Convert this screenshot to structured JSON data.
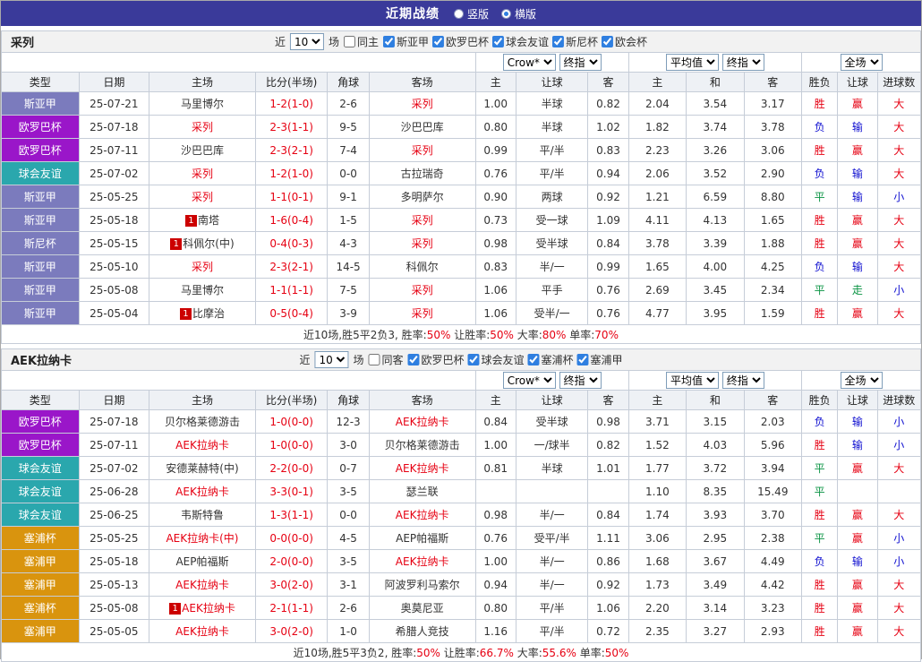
{
  "header": {
    "title": "近期战绩",
    "views": [
      {
        "label": "竖版",
        "selected": false
      },
      {
        "label": "横版",
        "selected": true
      }
    ]
  },
  "labels": {
    "near": "近",
    "games": "场"
  },
  "columns": [
    "类型",
    "日期",
    "主场",
    "比分(半场)",
    "角球",
    "客场",
    "主",
    "让球",
    "客",
    "主",
    "和",
    "客",
    "胜负",
    "让球",
    "进球数"
  ],
  "selects": {
    "provider": "Crow*",
    "final": "终指",
    "avg": "平均值",
    "scope": "全场"
  },
  "league_colors": {
    "斯亚甲": "#7b7bbd",
    "欧罗巴杯": "#9a16c9",
    "球会友谊": "#2aa7ad",
    "斯尼杯": "#7b7bbd",
    "欧会杯": "#7b7bbd",
    "塞浦杯": "#d9940e",
    "塞浦甲": "#d9940e"
  },
  "result_colors": {
    "胜": "#e60012",
    "负": "#1010d0",
    "平": "#0b9444",
    "赢": "#e60012",
    "输": "#1010d0",
    "走": "#0b9444",
    "大": "#e60012",
    "小": "#1010d0"
  },
  "tables": [
    {
      "team": "采列",
      "filter": {
        "count": "10",
        "same_label": "同主",
        "leagues": [
          "斯亚甲",
          "欧罗巴杯",
          "球会友谊",
          "斯尼杯",
          "欧会杯"
        ]
      },
      "rows": [
        {
          "league": "斯亚甲",
          "date": "25-07-21",
          "home": "马里博尔",
          "home_red": false,
          "home_badge": false,
          "score": "1-2(1-0)",
          "corner": "2-6",
          "away": "采列",
          "away_red": true,
          "away_badge": false,
          "odds": [
            "1.00",
            "半球",
            "0.82",
            "2.04",
            "3.54",
            "3.17"
          ],
          "res": [
            "胜",
            "赢",
            "大"
          ]
        },
        {
          "league": "欧罗巴杯",
          "date": "25-07-18",
          "home": "采列",
          "home_red": true,
          "home_badge": false,
          "score": "2-3(1-1)",
          "corner": "9-5",
          "away": "沙巴巴库",
          "away_red": false,
          "away_badge": false,
          "odds": [
            "0.80",
            "半球",
            "1.02",
            "1.82",
            "3.74",
            "3.78"
          ],
          "res": [
            "负",
            "输",
            "大"
          ]
        },
        {
          "league": "欧罗巴杯",
          "date": "25-07-11",
          "home": "沙巴巴库",
          "home_red": false,
          "home_badge": false,
          "score": "2-3(2-1)",
          "corner": "7-4",
          "away": "采列",
          "away_red": true,
          "away_badge": false,
          "odds": [
            "0.99",
            "平/半",
            "0.83",
            "2.23",
            "3.26",
            "3.06"
          ],
          "res": [
            "胜",
            "赢",
            "大"
          ]
        },
        {
          "league": "球会友谊",
          "date": "25-07-02",
          "home": "采列",
          "home_red": true,
          "home_badge": false,
          "score": "1-2(1-0)",
          "corner": "0-0",
          "away": "古拉瑞奇",
          "away_red": false,
          "away_badge": false,
          "odds": [
            "0.76",
            "平/半",
            "0.94",
            "2.06",
            "3.52",
            "2.90"
          ],
          "res": [
            "负",
            "输",
            "大"
          ]
        },
        {
          "league": "斯亚甲",
          "date": "25-05-25",
          "home": "采列",
          "home_red": true,
          "home_badge": false,
          "score": "1-1(0-1)",
          "corner": "9-1",
          "away": "多明萨尔",
          "away_red": false,
          "away_badge": false,
          "odds": [
            "0.90",
            "两球",
            "0.92",
            "1.21",
            "6.59",
            "8.80"
          ],
          "res": [
            "平",
            "输",
            "小"
          ]
        },
        {
          "league": "斯亚甲",
          "date": "25-05-18",
          "home": "南塔",
          "home_red": false,
          "home_badge": true,
          "score": "1-6(0-4)",
          "corner": "1-5",
          "away": "采列",
          "away_red": true,
          "away_badge": false,
          "odds": [
            "0.73",
            "受一球",
            "1.09",
            "4.11",
            "4.13",
            "1.65"
          ],
          "res": [
            "胜",
            "赢",
            "大"
          ]
        },
        {
          "league": "斯尼杯",
          "date": "25-05-15",
          "home": "科佩尔(中)",
          "home_red": false,
          "home_badge": true,
          "score": "0-4(0-3)",
          "corner": "4-3",
          "away": "采列",
          "away_red": true,
          "away_badge": false,
          "odds": [
            "0.98",
            "受半球",
            "0.84",
            "3.78",
            "3.39",
            "1.88"
          ],
          "res": [
            "胜",
            "赢",
            "大"
          ]
        },
        {
          "league": "斯亚甲",
          "date": "25-05-10",
          "home": "采列",
          "home_red": true,
          "home_badge": false,
          "score": "2-3(2-1)",
          "corner": "14-5",
          "away": "科佩尔",
          "away_red": false,
          "away_badge": false,
          "odds": [
            "0.83",
            "半/一",
            "0.99",
            "1.65",
            "4.00",
            "4.25"
          ],
          "res": [
            "负",
            "输",
            "大"
          ]
        },
        {
          "league": "斯亚甲",
          "date": "25-05-08",
          "home": "马里博尔",
          "home_red": false,
          "home_badge": false,
          "score": "1-1(1-1)",
          "corner": "7-5",
          "away": "采列",
          "away_red": true,
          "away_badge": false,
          "odds": [
            "1.06",
            "平手",
            "0.76",
            "2.69",
            "3.45",
            "2.34"
          ],
          "res": [
            "平",
            "走",
            "小"
          ]
        },
        {
          "league": "斯亚甲",
          "date": "25-05-04",
          "home": "比摩治",
          "home_red": false,
          "home_badge": true,
          "score": "0-5(0-4)",
          "corner": "3-9",
          "away": "采列",
          "away_red": true,
          "away_badge": false,
          "odds": [
            "1.06",
            "受半/一",
            "0.76",
            "4.77",
            "3.95",
            "1.59"
          ],
          "res": [
            "胜",
            "赢",
            "大"
          ]
        }
      ],
      "summary": {
        "prefix": "近10场,胜5平2负3,",
        "stats": [
          [
            "胜率:",
            "50%"
          ],
          [
            "让胜率:",
            "50%"
          ],
          [
            "大率:",
            "80%"
          ],
          [
            "单率:",
            "70%"
          ]
        ]
      }
    },
    {
      "team": "AEK拉纳卡",
      "filter": {
        "count": "10",
        "same_label": "同客",
        "leagues": [
          "欧罗巴杯",
          "球会友谊",
          "塞浦杯",
          "塞浦甲"
        ]
      },
      "rows": [
        {
          "league": "欧罗巴杯",
          "date": "25-07-18",
          "home": "贝尔格莱德游击",
          "home_red": false,
          "home_badge": false,
          "score": "1-0(0-0)",
          "corner": "12-3",
          "away": "AEK拉纳卡",
          "away_red": true,
          "away_badge": false,
          "odds": [
            "0.84",
            "受半球",
            "0.98",
            "3.71",
            "3.15",
            "2.03"
          ],
          "res": [
            "负",
            "输",
            "小"
          ]
        },
        {
          "league": "欧罗巴杯",
          "date": "25-07-11",
          "home": "AEK拉纳卡",
          "home_red": true,
          "home_badge": false,
          "score": "1-0(0-0)",
          "corner": "3-0",
          "away": "贝尔格莱德游击",
          "away_red": false,
          "away_badge": false,
          "odds": [
            "1.00",
            "一/球半",
            "0.82",
            "1.52",
            "4.03",
            "5.96"
          ],
          "res": [
            "胜",
            "输",
            "小"
          ]
        },
        {
          "league": "球会友谊",
          "date": "25-07-02",
          "home": "安德莱赫特(中)",
          "home_red": false,
          "home_badge": false,
          "score": "2-2(0-0)",
          "corner": "0-7",
          "away": "AEK拉纳卡",
          "away_red": true,
          "away_badge": false,
          "odds": [
            "0.81",
            "半球",
            "1.01",
            "1.77",
            "3.72",
            "3.94"
          ],
          "res": [
            "平",
            "赢",
            "大"
          ]
        },
        {
          "league": "球会友谊",
          "date": "25-06-28",
          "home": "AEK拉纳卡",
          "home_red": true,
          "home_badge": false,
          "score": "3-3(0-1)",
          "corner": "3-5",
          "away": "瑟兰联",
          "away_red": false,
          "away_badge": false,
          "odds": [
            "",
            "",
            "",
            "1.10",
            "8.35",
            "15.49"
          ],
          "res": [
            "平",
            "",
            ""
          ]
        },
        {
          "league": "球会友谊",
          "date": "25-06-25",
          "home": "韦斯特鲁",
          "home_red": false,
          "home_badge": false,
          "score": "1-3(1-1)",
          "corner": "0-0",
          "away": "AEK拉纳卡",
          "away_red": true,
          "away_badge": false,
          "odds": [
            "0.98",
            "半/一",
            "0.84",
            "1.74",
            "3.93",
            "3.70"
          ],
          "res": [
            "胜",
            "赢",
            "大"
          ]
        },
        {
          "league": "塞浦杯",
          "date": "25-05-25",
          "home": "AEK拉纳卡(中)",
          "home_red": true,
          "home_badge": false,
          "score": "0-0(0-0)",
          "corner": "4-5",
          "away": "AEP帕福斯",
          "away_red": false,
          "away_badge": false,
          "odds": [
            "0.76",
            "受平/半",
            "1.11",
            "3.06",
            "2.95",
            "2.38"
          ],
          "res": [
            "平",
            "赢",
            "小"
          ]
        },
        {
          "league": "塞浦甲",
          "date": "25-05-18",
          "home": "AEP帕福斯",
          "home_red": false,
          "home_badge": false,
          "score": "2-0(0-0)",
          "corner": "3-5",
          "away": "AEK拉纳卡",
          "away_red": true,
          "away_badge": false,
          "odds": [
            "1.00",
            "半/一",
            "0.86",
            "1.68",
            "3.67",
            "4.49"
          ],
          "res": [
            "负",
            "输",
            "小"
          ]
        },
        {
          "league": "塞浦甲",
          "date": "25-05-13",
          "home": "AEK拉纳卡",
          "home_red": true,
          "home_badge": false,
          "score": "3-0(2-0)",
          "corner": "3-1",
          "away": "阿波罗利马索尔",
          "away_red": false,
          "away_badge": false,
          "odds": [
            "0.94",
            "半/一",
            "0.92",
            "1.73",
            "3.49",
            "4.42"
          ],
          "res": [
            "胜",
            "赢",
            "大"
          ]
        },
        {
          "league": "塞浦杯",
          "date": "25-05-08",
          "home": "AEK拉纳卡",
          "home_red": true,
          "home_badge": true,
          "score": "2-1(1-1)",
          "corner": "2-6",
          "away": "奥莫尼亚",
          "away_red": false,
          "away_badge": false,
          "odds": [
            "0.80",
            "平/半",
            "1.06",
            "2.20",
            "3.14",
            "3.23"
          ],
          "res": [
            "胜",
            "赢",
            "大"
          ]
        },
        {
          "league": "塞浦甲",
          "date": "25-05-05",
          "home": "AEK拉纳卡",
          "home_red": true,
          "home_badge": false,
          "score": "3-0(2-0)",
          "corner": "1-0",
          "away": "希腊人竞技",
          "away_red": false,
          "away_badge": false,
          "odds": [
            "1.16",
            "平/半",
            "0.72",
            "2.35",
            "3.27",
            "2.93"
          ],
          "res": [
            "胜",
            "赢",
            "大"
          ]
        }
      ],
      "summary": {
        "prefix": "近10场,胜5平3负2,",
        "stats": [
          [
            "胜率:",
            "50%"
          ],
          [
            "让胜率:",
            "66.7%"
          ],
          [
            "大率:",
            "55.6%"
          ],
          [
            "单率:",
            "50%"
          ]
        ]
      }
    }
  ]
}
